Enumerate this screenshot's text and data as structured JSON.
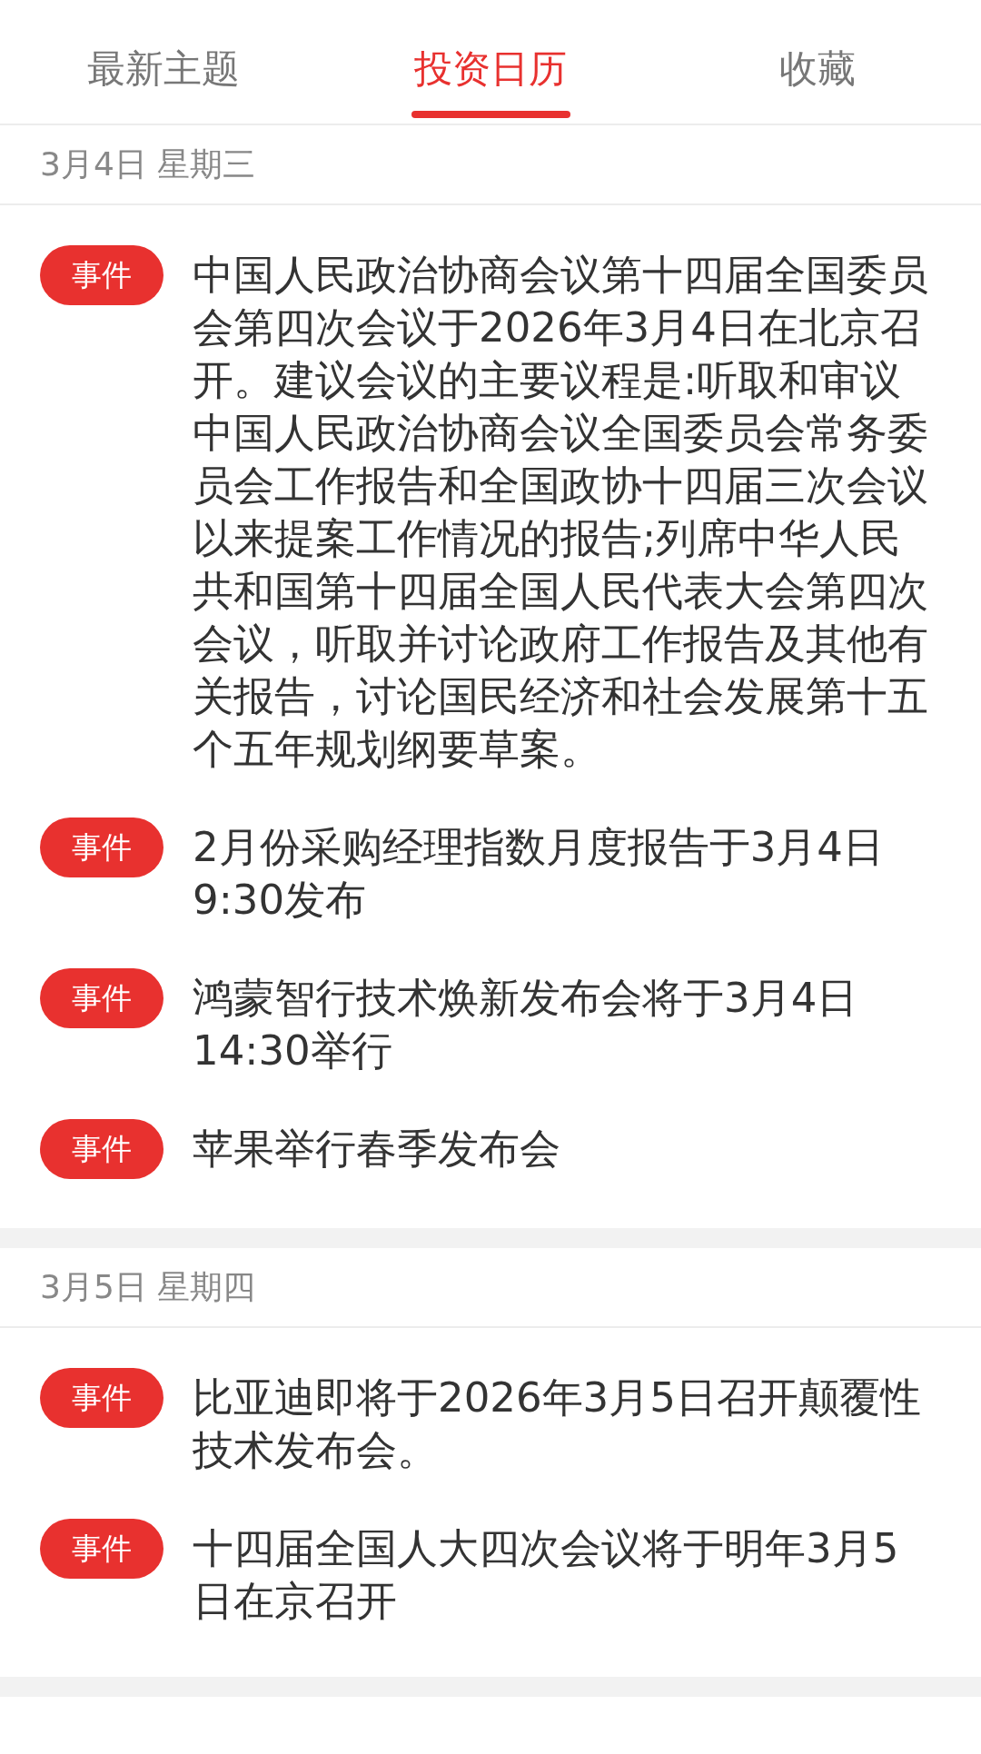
{
  "tabs": [
    {
      "label": "最新主题",
      "selected": false
    },
    {
      "label": "投资日历",
      "selected": true
    },
    {
      "label": "收藏",
      "selected": false
    }
  ],
  "sections": [
    {
      "date": "3月4日 星期三",
      "events": [
        {
          "tag": "事件",
          "text": "中国人民政治协商会议第十四届全国委员会第四次会议于2026年3月4日在北京召开。建议会议的主要议程是:听取和审议中国人民政治协商会议全国委员会常务委员会工作报告和全国政协十四届三次会议以来提案工作情况的报告;列席中华人民共和国第十四届全国人民代表大会第四次会议，听取并讨论政府工作报告及其他有关报告，讨论国民经济和社会发展第十五个五年规划纲要草案。"
        },
        {
          "tag": "事件",
          "text": "2月份采购经理指数月度报告于3月4日9:30发布"
        },
        {
          "tag": "事件",
          "text": "鸿蒙智行技术焕新发布会将于3月4日14:30举行"
        },
        {
          "tag": "事件",
          "text": "苹果举行春季发布会"
        }
      ]
    },
    {
      "date": "3月5日 星期四",
      "events": [
        {
          "tag": "事件",
          "text": "比亚迪即将于2026年3月5日召开颠覆性技术发布会。"
        },
        {
          "tag": "事件",
          "text": "十四届全国人大四次会议将于明年3月5日在京召开"
        }
      ]
    }
  ]
}
